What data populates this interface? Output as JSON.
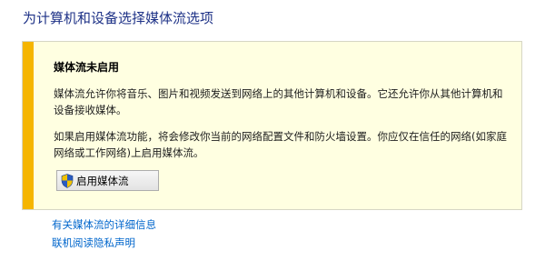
{
  "page": {
    "title": "为计算机和设备选择媒体流选项"
  },
  "notice": {
    "heading": "媒体流未启用",
    "paragraph1": "媒体流允许你将音乐、图片和视频发送到网络上的其他计算机和设备。它还允许你从其他计算机和设备接收媒体。",
    "paragraph2": "如果启用媒体流功能，将会修改你当前的网络配置文件和防火墙设置。你应仅在信任的网络(如家庭网络或工作网络)上启用媒体流。",
    "accent_color": "#f5b500",
    "background_color": "#ffffe1"
  },
  "enable_button": {
    "label": "启用媒体流",
    "icon": "uac-shield-icon"
  },
  "links": {
    "more_info": "有关媒体流的详细信息",
    "privacy": "联机阅读隐私声明"
  }
}
